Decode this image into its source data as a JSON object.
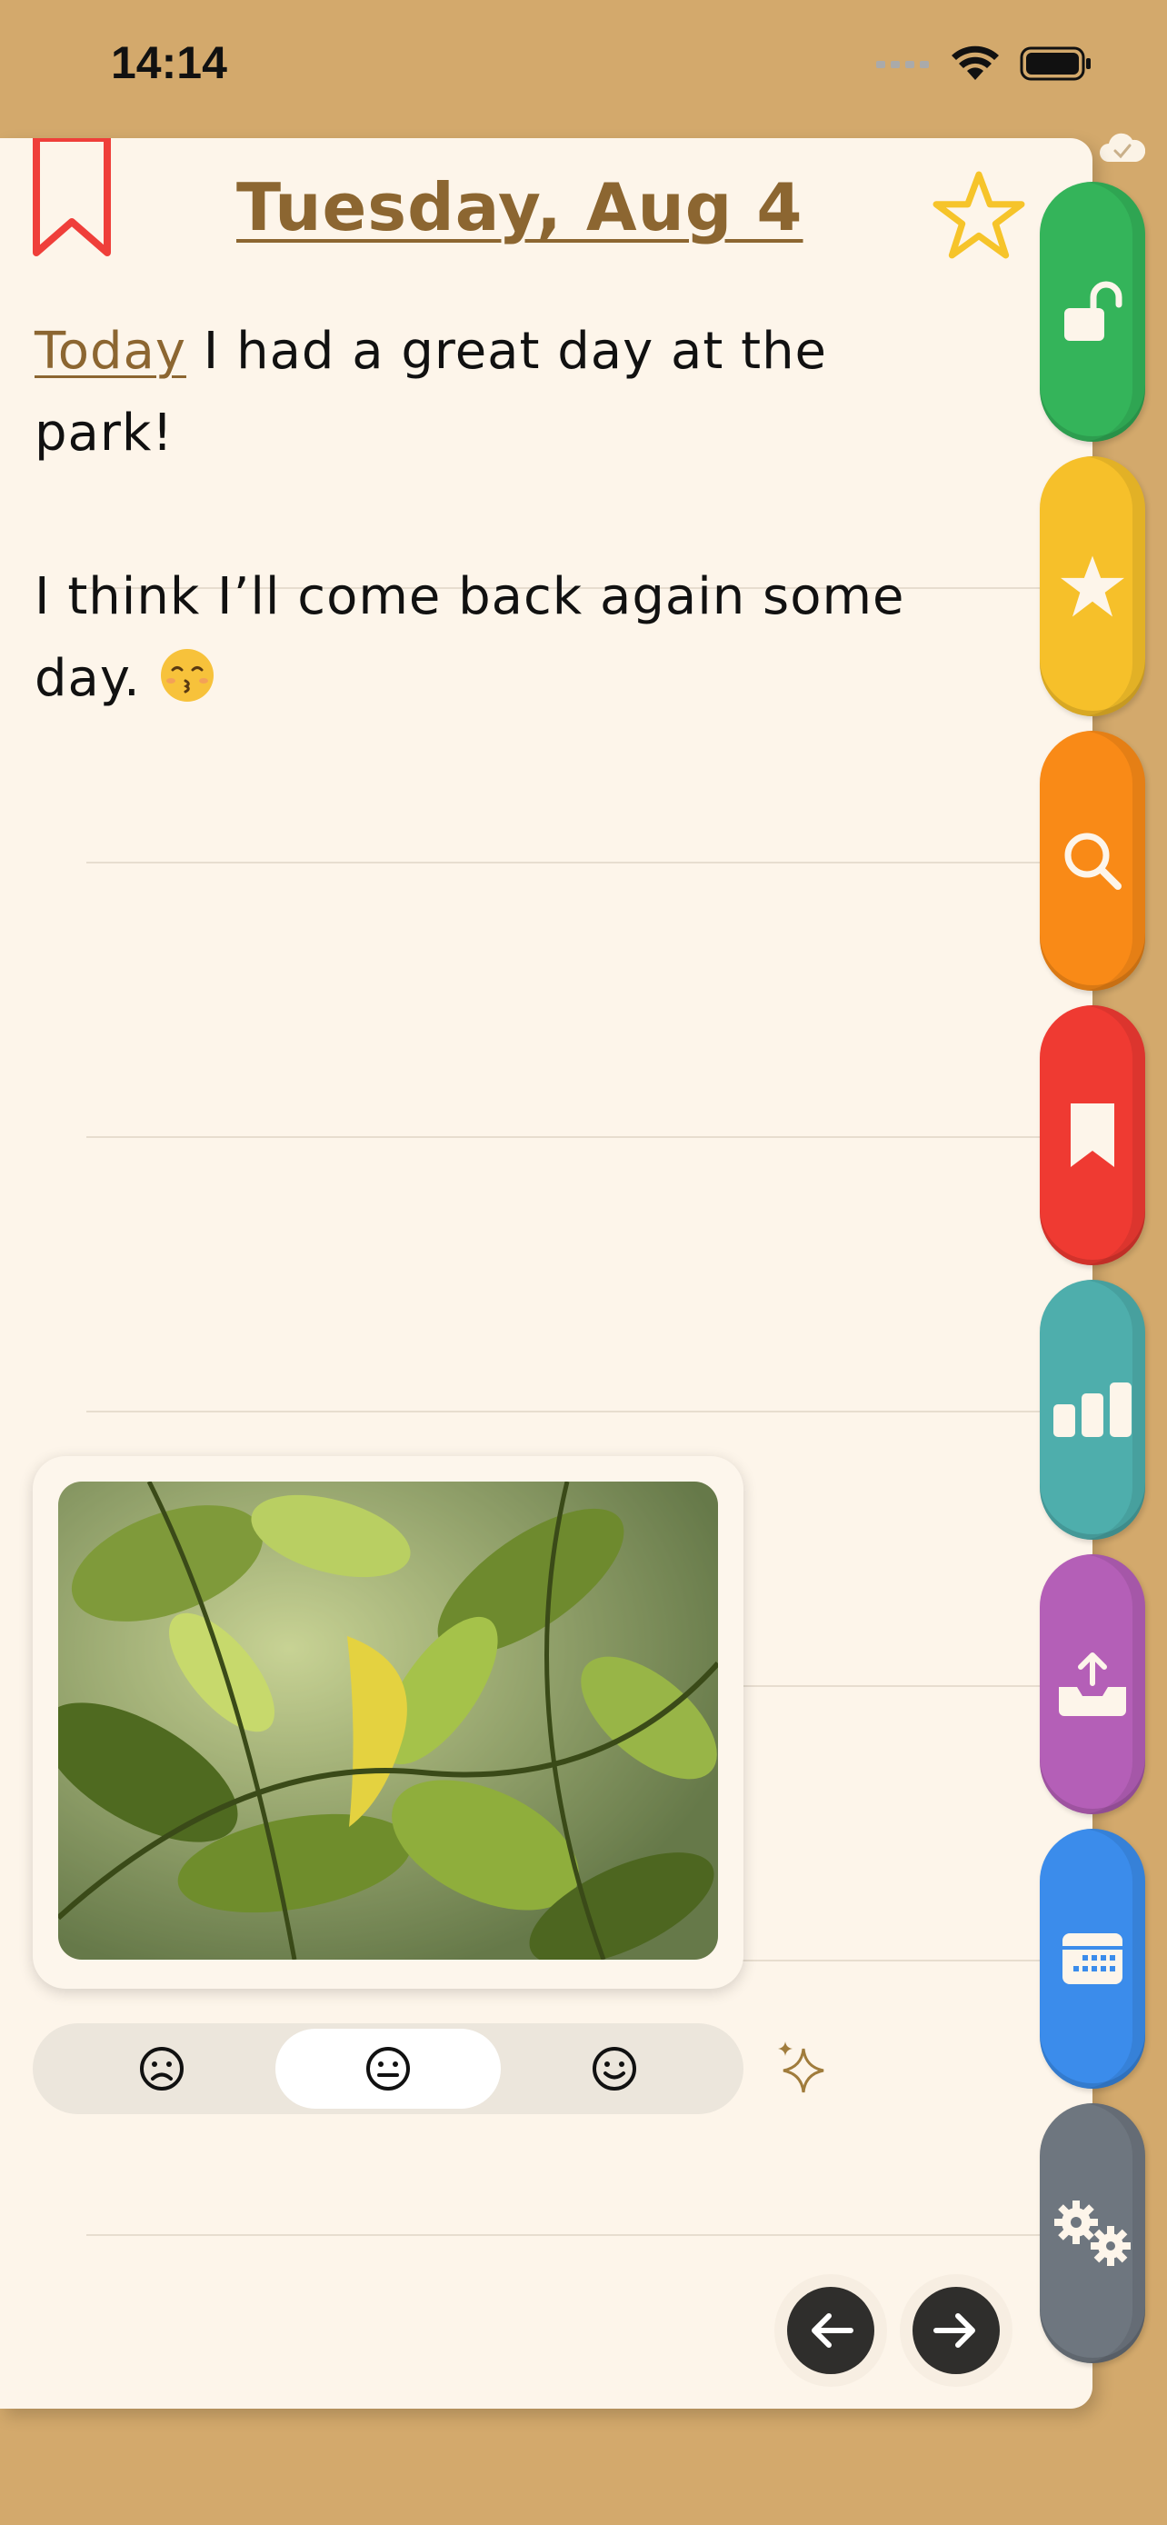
{
  "status_bar": {
    "time": "14:14"
  },
  "header": {
    "date_title": "Tuesday, Aug 4"
  },
  "entry": {
    "link_word": "Today",
    "line1_rest": " I had a great day at the park!",
    "line2": "I think I’ll come back again some day. "
  },
  "mood": {
    "options": [
      "sad",
      "neutral",
      "happy"
    ],
    "selected": "neutral"
  },
  "tabs": [
    {
      "name": "lock",
      "color": "#34b45a"
    },
    {
      "name": "favorites",
      "color": "#f6c02a"
    },
    {
      "name": "search",
      "color": "#f98a17"
    },
    {
      "name": "bookmarks",
      "color": "#ef3a32"
    },
    {
      "name": "stats",
      "color": "#4eaeac"
    },
    {
      "name": "export",
      "color": "#b45fb7"
    },
    {
      "name": "calendar",
      "color": "#3b8ceb"
    },
    {
      "name": "settings",
      "color": "#6e767f"
    }
  ],
  "colors": {
    "background": "#d3a96c",
    "page": "#fdf5ea",
    "accent_brown": "#8c6631",
    "bookmark_red": "#ef3f3a",
    "star_yellow": "#f6c42a"
  },
  "icons": [
    "bookmark-icon",
    "star-icon",
    "add-calendar-icon",
    "sparkles-icon",
    "cloud-check-icon",
    "left-arrow-icon",
    "right-arrow-icon"
  ]
}
